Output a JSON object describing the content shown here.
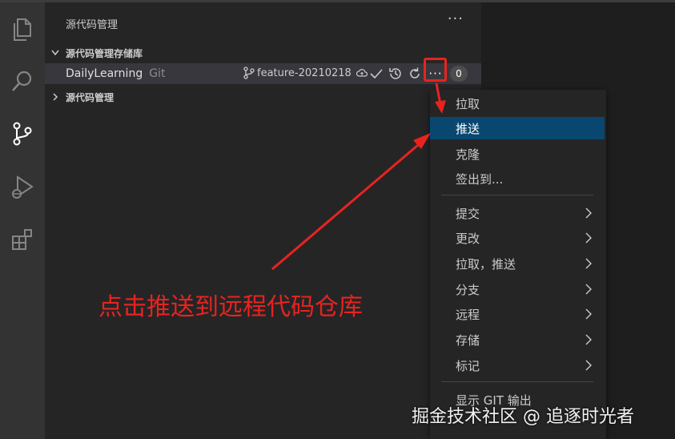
{
  "activity_bar": {
    "icons": [
      "explorer-icon",
      "search-icon",
      "source-control-icon",
      "run-debug-icon",
      "extensions-icon"
    ]
  },
  "sidebar": {
    "title": "源代码管理",
    "more_label": "···",
    "repos_section_label": "源代码管理存储库",
    "scm_section_label": "源代码管理",
    "repo": {
      "name": "DailyLearning",
      "type": "Git",
      "branch": "feature-20210218",
      "more_label": "···",
      "count": "0"
    }
  },
  "menu": {
    "items_top": [
      "拉取",
      "推送",
      "克隆",
      "签出到..."
    ],
    "selected": "推送",
    "items_sub": [
      "提交",
      "更改",
      "拉取，推送",
      "分支",
      "远程",
      "存储",
      "标记"
    ],
    "items_bottom": [
      "显示 GIT 输出"
    ]
  },
  "annotation": {
    "text": "点击推送到远程代码仓库",
    "color": "#e8231f"
  },
  "watermark": "掘金技术社区 @ 追逐时光者",
  "colors": {
    "activity_bar": "#333333",
    "sidebar": "#252526",
    "selected_item": "#094771",
    "annotation_red": "#e8231f"
  }
}
